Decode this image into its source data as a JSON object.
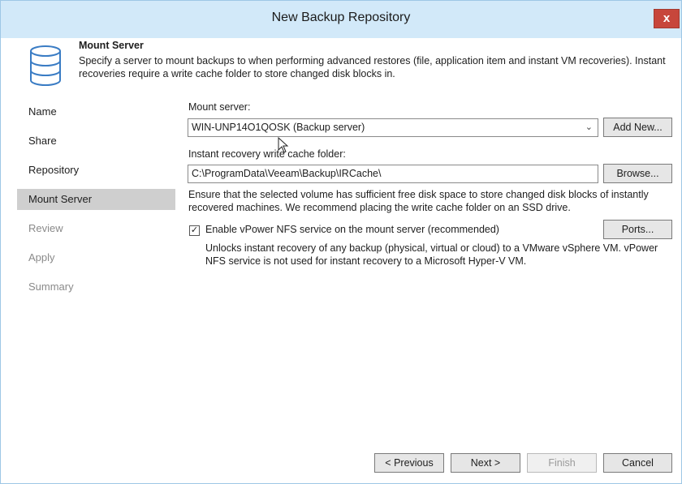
{
  "window": {
    "title": "New Backup Repository",
    "close_label": "x"
  },
  "header": {
    "title": "Mount Server",
    "description": "Specify a server to mount backups to when performing advanced restores (file, application item and instant VM recoveries). Instant recoveries require a write cache folder to store changed disk blocks in."
  },
  "nav": {
    "items": [
      {
        "label": "Name"
      },
      {
        "label": "Share"
      },
      {
        "label": "Repository"
      },
      {
        "label": "Mount Server"
      },
      {
        "label": "Review"
      },
      {
        "label": "Apply"
      },
      {
        "label": "Summary"
      }
    ]
  },
  "form": {
    "mount_server_label": "Mount server:",
    "mount_server_value": "WIN-UNP14O1QOSK (Backup server)",
    "add_new_label": "Add New...",
    "cache_folder_label": "Instant recovery write cache folder:",
    "cache_folder_value": "C:\\ProgramData\\Veeam\\Backup\\IRCache\\",
    "browse_label": "Browse...",
    "disk_note": "Ensure that the selected volume has sufficient free disk space to store changed disk blocks of instantly recovered machines. We recommend placing the write cache folder on an SSD drive.",
    "nfs_checkbox_label": "Enable vPower NFS service on the mount server (recommended)",
    "nfs_checked": true,
    "ports_label": "Ports...",
    "nfs_note": "Unlocks instant recovery of any backup (physical, virtual or cloud) to a VMware vSphere VM. vPower NFS service is not used for instant recovery to a Microsoft Hyper-V VM."
  },
  "footer": {
    "previous_label": "< Previous",
    "next_label": "Next >",
    "finish_label": "Finish",
    "cancel_label": "Cancel"
  },
  "colors": {
    "titlebar": "#d2e9f9",
    "close": "#c7463b",
    "active_nav": "#cfcfcf",
    "icon_blue": "#3a7cc4"
  }
}
